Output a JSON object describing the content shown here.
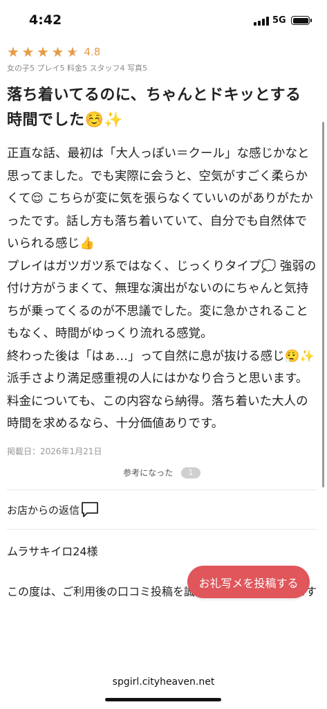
{
  "status_bar": {
    "time": "4:42",
    "network": "5G"
  },
  "review": {
    "rating": 4.5,
    "rating_text": "4.8",
    "stars": [
      "★",
      "★",
      "★",
      "★",
      "★"
    ],
    "scores": "女の子5 プレイ5 料金5 スタッフ4 写真5",
    "title": "落ち着いてるのに、ちゃんとドキッとする時間でした☺️✨",
    "body": [
      "正直な話、最初は「大人っぽい＝クール」な感じかなと思ってました。でも実際に会うと、空気がすごく柔らかくて😌 こちらが変に気を張らなくていいのがありがたかったです。話し方も落ち着いていて、自分でも自然体でいられる感じ👍",
      "プレイはガツガツ系ではなく、じっくりタイプ💭 強弱の付け方がうまくて、無理な演出がないのにちゃんと気持ちが乗ってくるのが不思議でした。変に急かされることもなく、時間がゆっくり流れる感覚。",
      "終わった後は「はぁ…」って自然に息が抜ける感じ😮‍💨✨ 派手さより満足感重視の人にはかなり合うと思います。料金についても、この内容なら納得。落ち着いた大人の時間を求めるなら、十分価値ありです。"
    ],
    "posted_date": "掲載日：2026年1月21日",
    "helpful_label": "参考になった",
    "helpful_count": "1"
  },
  "shop_reply": {
    "label": "お店からの返信",
    "icon": "chat-bubble-icon",
    "reviewer": "ムラサキイロ24様",
    "text": "この度は、ご利用後の口コミ投稿を誠にありがとうございます"
  },
  "cta_button": {
    "label": "お礼写メを投稿する",
    "color": "#e0565b"
  },
  "browser": {
    "url": "spgirl.cityheaven.net"
  },
  "colors": {
    "accent": "#e79a45"
  }
}
